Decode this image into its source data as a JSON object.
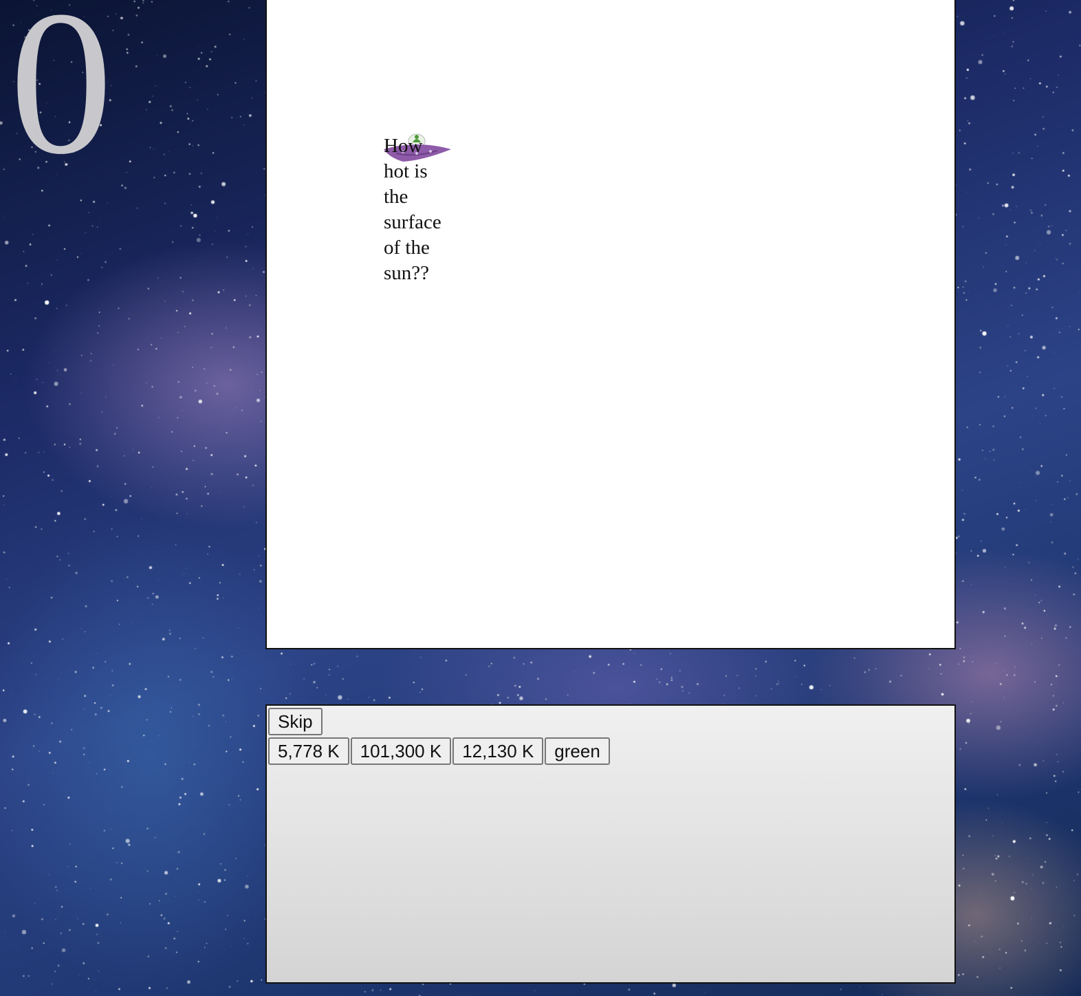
{
  "score": "0",
  "question": {
    "text": "How hot is the surface of the sun??",
    "icon": "ufo-icon"
  },
  "controls": {
    "skip_label": "Skip"
  },
  "answers": [
    {
      "label": "5,778 K"
    },
    {
      "label": "101,300 K"
    },
    {
      "label": "12,130 K"
    },
    {
      "label": "green"
    }
  ],
  "colors": {
    "game_area_background": "#ffffff",
    "panel_border": "#111111",
    "score_color": "#c8c8cc",
    "ufo_body": "#8e5ba8",
    "alien_green": "#4f9a3a"
  }
}
